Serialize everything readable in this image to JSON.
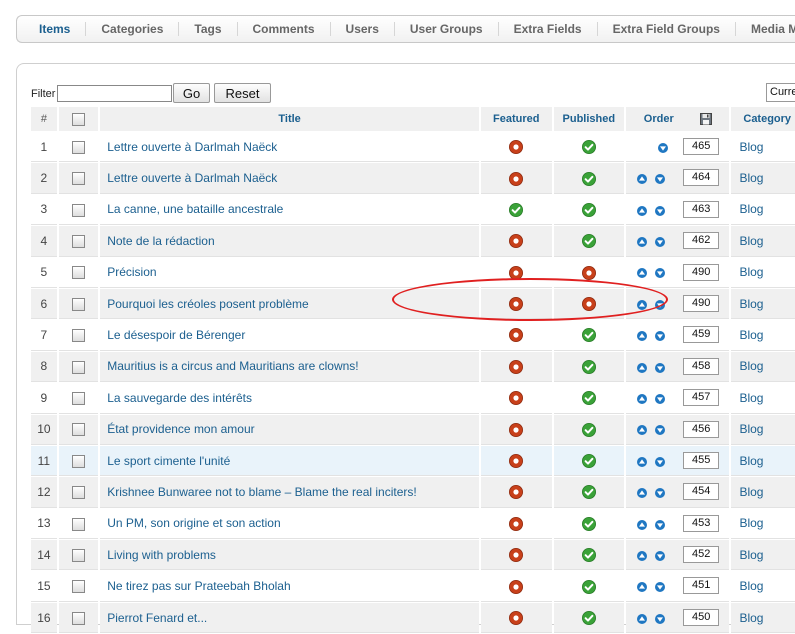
{
  "tabs": [
    "Items",
    "Categories",
    "Tags",
    "Comments",
    "Users",
    "User Groups",
    "Extra Fields",
    "Extra Field Groups",
    "Media Ma"
  ],
  "filter": {
    "label": "Filter",
    "value": "",
    "go": "Go",
    "reset": "Reset"
  },
  "state_select": "Curre",
  "columns": {
    "num": "#",
    "title": "Title",
    "featured": "Featured",
    "published": "Published",
    "order": "Order",
    "category": "Category"
  },
  "colors": {
    "link": "#1b5f8f",
    "red_status": "#c8401a",
    "green_status": "#3aa238",
    "annotation": "#e02020"
  },
  "icons": {
    "featured_off": "red-disc-icon",
    "featured_on": "green-check-icon",
    "up": "arrow-up-icon",
    "down": "arrow-down-icon",
    "save_order": "floppy-disk-icon"
  },
  "rows": [
    {
      "num": "1",
      "title": "Lettre ouverte à Darlmah Naëck",
      "featured": "red",
      "published": "green",
      "up": false,
      "down": true,
      "order": "465",
      "category": "Blog"
    },
    {
      "num": "2",
      "title": "Lettre ouverte à Darlmah Naëck",
      "featured": "red",
      "published": "green",
      "up": true,
      "down": true,
      "order": "464",
      "category": "Blog"
    },
    {
      "num": "3",
      "title": "La canne, une bataille ancestrale",
      "featured": "green",
      "published": "green",
      "up": true,
      "down": true,
      "order": "463",
      "category": "Blog"
    },
    {
      "num": "4",
      "title": "Note de la rédaction",
      "featured": "red",
      "published": "green",
      "up": true,
      "down": true,
      "order": "462",
      "category": "Blog"
    },
    {
      "num": "5",
      "title": "Précision",
      "featured": "red",
      "published": "red",
      "up": true,
      "down": true,
      "order": "490",
      "category": "Blog"
    },
    {
      "num": "6",
      "title": "Pourquoi les créoles posent problème",
      "featured": "red",
      "published": "red",
      "up": true,
      "down": true,
      "order": "490",
      "category": "Blog"
    },
    {
      "num": "7",
      "title": "Le désespoir de Bérenger",
      "featured": "red",
      "published": "green",
      "up": true,
      "down": true,
      "order": "459",
      "category": "Blog"
    },
    {
      "num": "8",
      "title": "Mauritius is a circus and Mauritians are clowns!",
      "featured": "red",
      "published": "green",
      "up": true,
      "down": true,
      "order": "458",
      "category": "Blog"
    },
    {
      "num": "9",
      "title": "La sauvegarde des intérêts",
      "featured": "red",
      "published": "green",
      "up": true,
      "down": true,
      "order": "457",
      "category": "Blog"
    },
    {
      "num": "10",
      "title": "État providence mon amour",
      "featured": "red",
      "published": "green",
      "up": true,
      "down": true,
      "order": "456",
      "category": "Blog"
    },
    {
      "num": "11",
      "title": "Le sport cimente l'unité",
      "featured": "red",
      "published": "green",
      "up": true,
      "down": true,
      "order": "455",
      "category": "Blog"
    },
    {
      "num": "12",
      "title": "Krishnee Bunwaree not to blame – Blame the real inciters!",
      "featured": "red",
      "published": "green",
      "up": true,
      "down": true,
      "order": "454",
      "category": "Blog"
    },
    {
      "num": "13",
      "title": "Un PM, son origine et son action",
      "featured": "red",
      "published": "green",
      "up": true,
      "down": true,
      "order": "453",
      "category": "Blog"
    },
    {
      "num": "14",
      "title": "Living with problems",
      "featured": "red",
      "published": "green",
      "up": true,
      "down": true,
      "order": "452",
      "category": "Blog"
    },
    {
      "num": "15",
      "title": "Ne tirez pas sur Prateebah Bholah",
      "featured": "red",
      "published": "green",
      "up": true,
      "down": true,
      "order": "451",
      "category": "Blog"
    },
    {
      "num": "16",
      "title": "Pierrot Fenard et...",
      "featured": "red",
      "published": "green",
      "up": true,
      "down": true,
      "order": "450",
      "category": "Blog"
    }
  ]
}
